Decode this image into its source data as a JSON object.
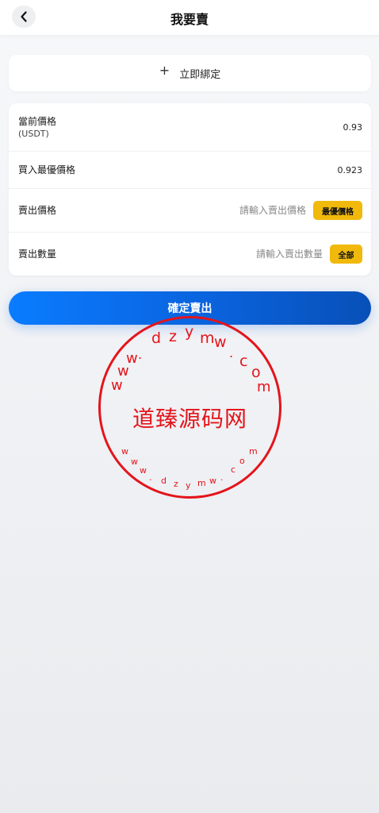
{
  "header": {
    "title": "我要賣",
    "back_icon": "chevron-left-icon"
  },
  "bind": {
    "label": "立即綁定",
    "icon": "plus-icon"
  },
  "form": {
    "current_price": {
      "label": "當前價格",
      "unit": "(USDT)",
      "value": "0.93"
    },
    "best_buy_price": {
      "label": "買入最優價格",
      "value": "0.923"
    },
    "sell_price": {
      "label": "賣出價格",
      "placeholder": "請輸入賣出價格",
      "button": "最優價格"
    },
    "sell_quantity": {
      "label": "賣出數量",
      "placeholder": "請輸入賣出數量",
      "button": "全部"
    }
  },
  "confirm": {
    "label": "確定賣出"
  },
  "stamp": {
    "center_text": "道臻源码网",
    "top_arc": [
      "w",
      "w",
      "w",
      ".",
      "d",
      "z",
      "y",
      "m",
      "w",
      ".",
      "c",
      "o",
      "m"
    ],
    "bottom_arc": [
      "w",
      "w",
      "w",
      ".",
      "d",
      "z",
      "y",
      "m",
      "w",
      ".",
      "c",
      "o",
      "m"
    ]
  },
  "colors": {
    "accent_yellow": "#f0b90b",
    "primary_blue": "#0a63dd",
    "stamp_red": "#e4141b"
  }
}
